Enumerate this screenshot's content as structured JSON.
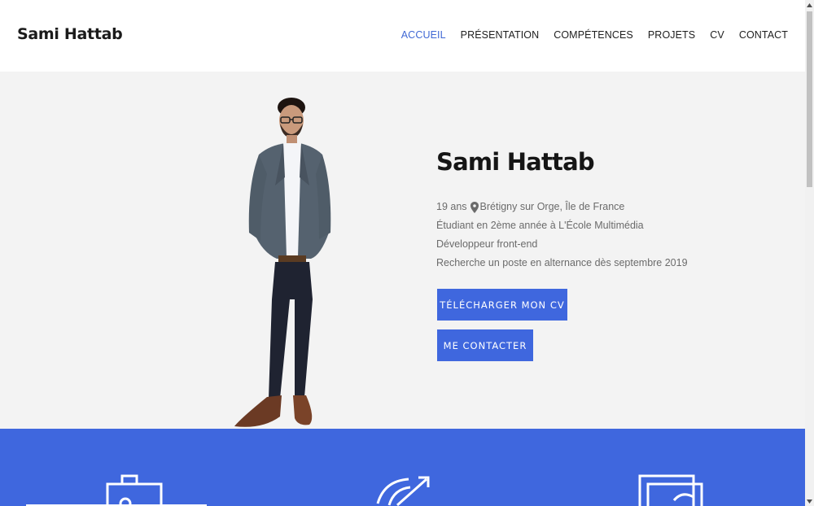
{
  "header": {
    "brand": "Sami Hattab",
    "nav": [
      {
        "label": "ACCUEIL",
        "active": true
      },
      {
        "label": "PRÉSENTATION",
        "active": false
      },
      {
        "label": "COMPÉTENCES",
        "active": false
      },
      {
        "label": "PROJETS",
        "active": false
      },
      {
        "label": "CV",
        "active": false
      },
      {
        "label": "CONTACT",
        "active": false
      }
    ]
  },
  "hero": {
    "name": "Sami Hattab",
    "age": "19 ans",
    "location": "Brétigny sur Orge, Île de France",
    "lines": [
      "Étudiant en 2ème année à L'École Multimédia",
      "Développeur front-end",
      "Recherche un poste en alternance dès septembre 2019"
    ],
    "buttons": {
      "download_cv": "TÉLÉCHARGER MON CV",
      "contact": "ME CONTACTER"
    },
    "icons": {
      "location": "map-pin-icon",
      "photo": "person-photo"
    }
  },
  "features": {
    "icons": [
      "id-card-icon",
      "target-arrow-icon",
      "portfolio-images-icon"
    ]
  },
  "colors": {
    "accent": "#3f67de",
    "hero_bg": "#f3f3f3",
    "text_dark": "#151515",
    "text_muted": "#6b6b6b"
  }
}
